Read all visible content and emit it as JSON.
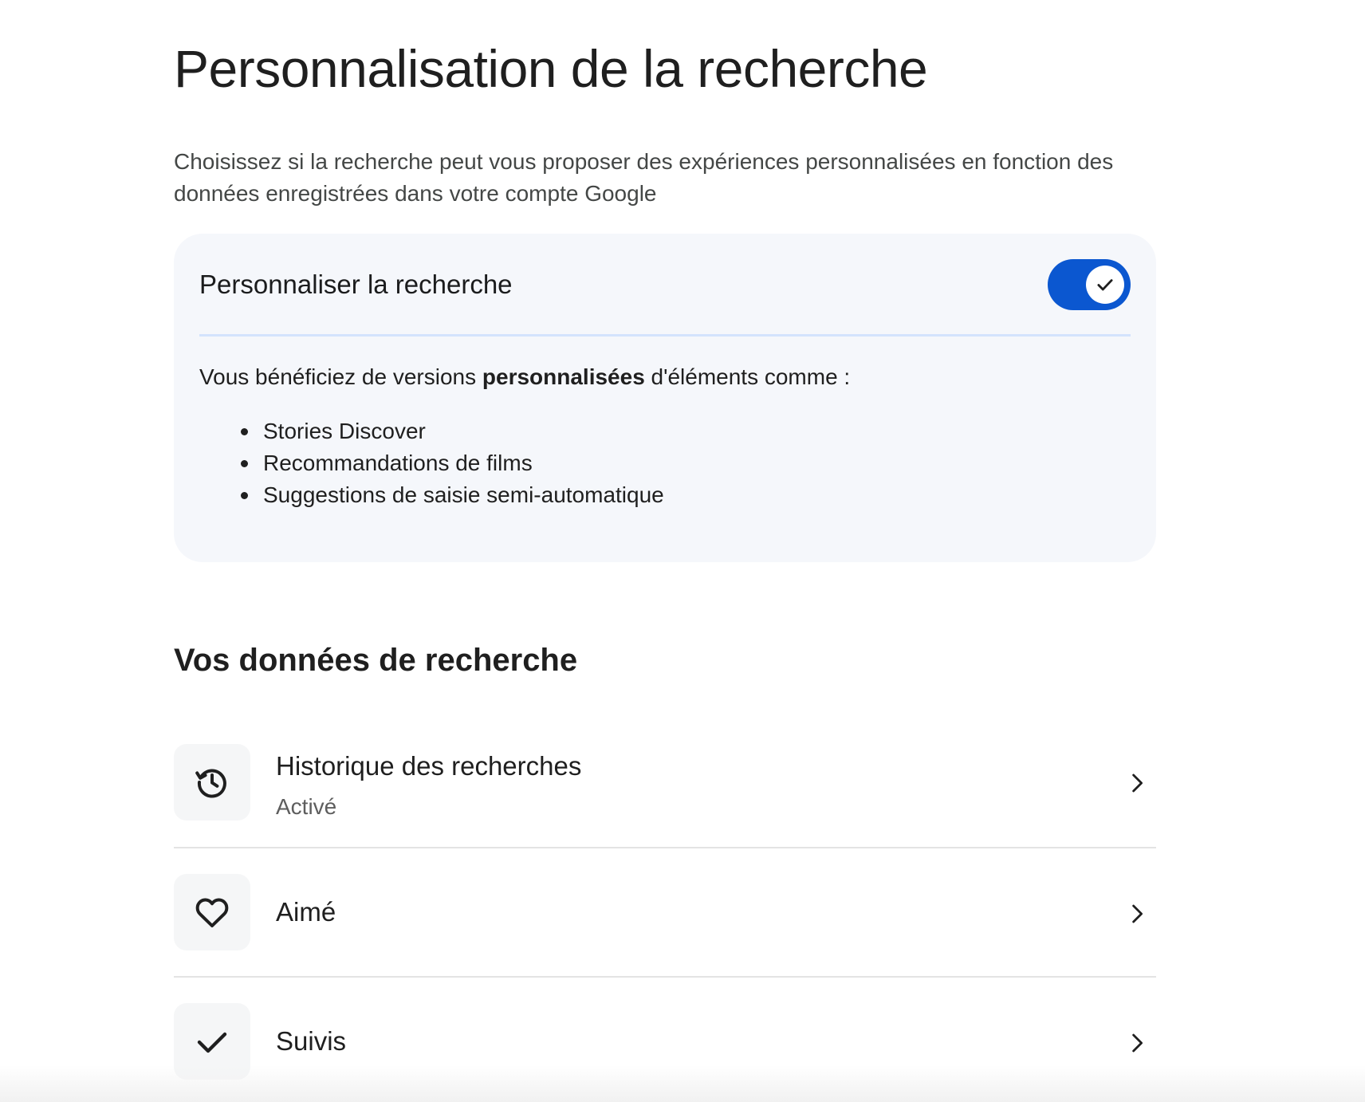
{
  "page": {
    "title": "Personnalisation de la recherche",
    "intro": "Choisissez si la recherche peut vous proposer des expériences personnalisées en fonction des données enregistrées dans votre compte Google"
  },
  "personalize_card": {
    "title": "Personnaliser la recherche",
    "toggle_on": true,
    "accent_color": "#0b57d0",
    "lead_before": "Vous bénéficiez de versions ",
    "lead_bold": "personnalisées",
    "lead_after": " d'éléments comme :",
    "features": [
      "Stories Discover",
      "Recommandations de films",
      "Suggestions de saisie semi-automatique"
    ]
  },
  "search_data": {
    "title": "Vos données de recherche",
    "items": [
      {
        "icon": "history-icon",
        "label": "Historique des recherches",
        "status": "Activé"
      },
      {
        "icon": "heart-icon",
        "label": "Aimé"
      },
      {
        "icon": "check-icon",
        "label": "Suivis"
      }
    ]
  }
}
